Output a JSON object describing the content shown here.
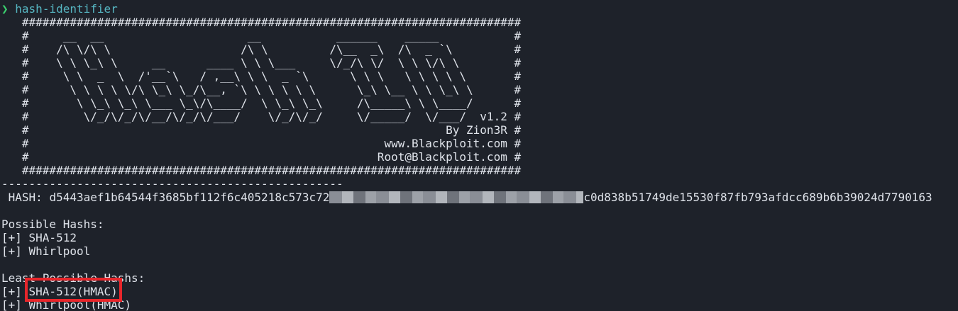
{
  "prompt": {
    "symbol": "❯",
    "command": "hash-identifier"
  },
  "banner": {
    "lines": [
      "   #########################################################################",
      "   #     __  __                     __           ______    _____           #",
      "   #    /\\ \\/\\ \\                   /\\ \\         /\\__  _\\  /\\  _ `\\         #",
      "   #    \\ \\ \\_\\ \\     __      ____ \\ \\ \\___     \\/_/\\ \\/  \\ \\ \\/\\ \\        #",
      "   #     \\ \\  _  \\  /'__`\\   / ,__\\ \\ \\  _ `\\      \\ \\ \\   \\ \\ \\ \\ \\       #",
      "   #      \\ \\ \\ \\ \\/\\ \\_\\ \\_/\\__, `\\ \\ \\ \\ \\ \\      \\_\\ \\__ \\ \\ \\_\\ \\      #",
      "   #       \\ \\_\\ \\_\\ \\___ \\_\\/\\____/  \\ \\_\\ \\_\\     /\\_____\\ \\ \\____/      #",
      "   #        \\/_/\\/_/\\/__/\\/_/\\/___/    \\/_/\\/_/     \\/_____/  \\/___/  v1.2 #",
      "   #                                                             By Zion3R #",
      "   #                                                    www.Blackploit.com #",
      "   #                                                   Root@Blackploit.com #",
      "   #########################################################################"
    ]
  },
  "output": {
    "separator": "--------------------------------------------------",
    "hash_label": " HASH: ",
    "hash_prefix": "d5443aef1b64544f3685bf112f6c405218c573c72",
    "hash_suffix": "c0d838b51749de15530f87fb793afdcc689b6b39024d7790163",
    "possible_title": "Possible Hashs:",
    "possible": [
      "[+] SHA-512",
      "[+] Whirlpool"
    ],
    "least_title": "Least Possible Hashs:",
    "least": [
      "[+] SHA-512(HMAC)",
      "[+] Whirlpool(HMAC)"
    ]
  },
  "colors": {
    "background": "#1e222a",
    "foreground": "#dfe3ea",
    "prompt_symbol": "#3bd16f",
    "prompt_command": "#56b6c2",
    "highlight_border": "#e8262b"
  }
}
